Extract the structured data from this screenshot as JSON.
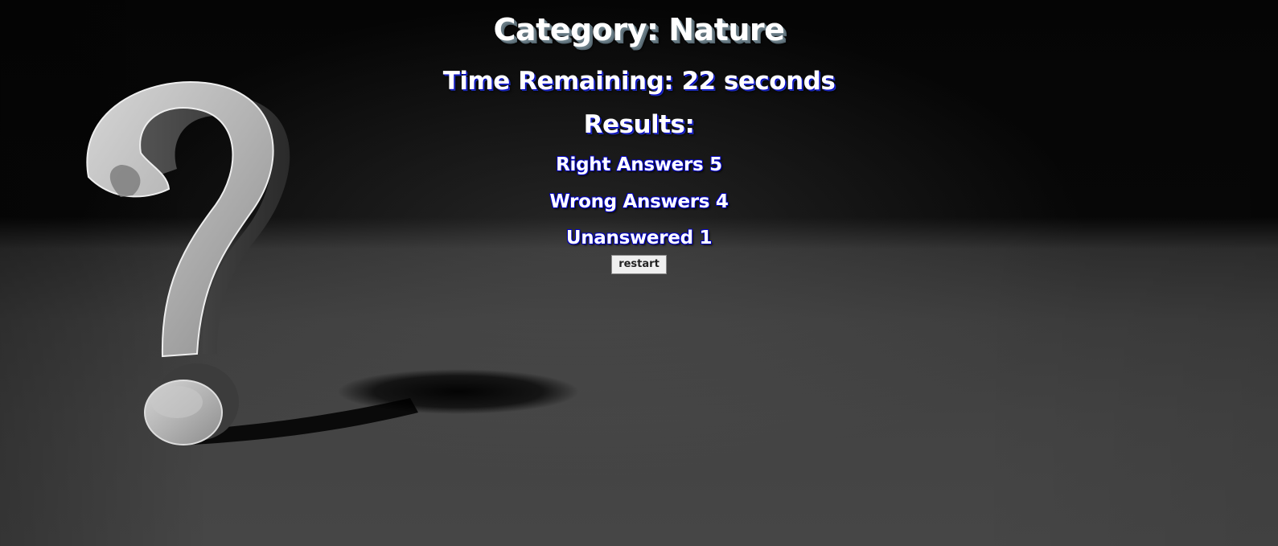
{
  "quiz": {
    "category_title": "Category: Nature",
    "time_remaining": "Time Remaining: 22 seconds",
    "results_heading": "Results:",
    "right_answers": "Right Answers 5",
    "wrong_answers": "Wrong Answers 4",
    "unanswered": "Unanswered 1",
    "restart_label": "restart"
  },
  "background": {
    "image_subject": "question-mark-icon",
    "colors": {
      "wall": "#050505",
      "floor": "#464646",
      "question_mark": "#b8b8b8"
    }
  }
}
